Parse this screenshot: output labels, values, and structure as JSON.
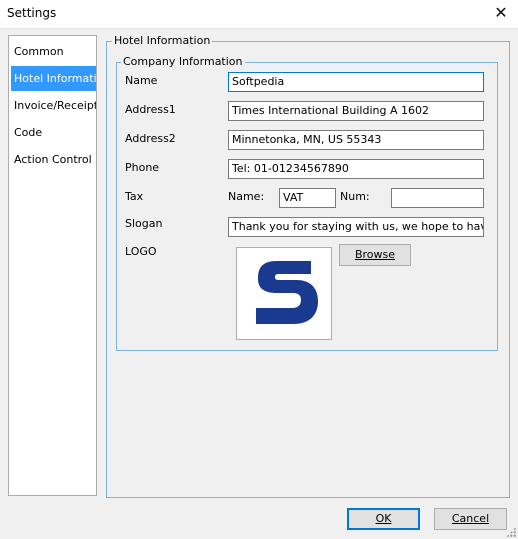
{
  "window": {
    "title": "Settings"
  },
  "nav": {
    "items": [
      {
        "label": "Common"
      },
      {
        "label": "Hotel Information"
      },
      {
        "label": "Invoice/Receipt"
      },
      {
        "label": "Code"
      },
      {
        "label": "Action Control"
      }
    ],
    "selected_index": 1
  },
  "hotel_group": {
    "legend": "Hotel Information"
  },
  "company_group": {
    "legend": "Company Information",
    "name": {
      "label": "Name",
      "value": "Softpedia"
    },
    "address1": {
      "label": "Address1",
      "value": "Times International Building A 1602"
    },
    "address2": {
      "label": "Address2",
      "value": "Minnetonka, MN, US 55343"
    },
    "phone": {
      "label": "Phone",
      "value": "Tel: 01-01234567890"
    },
    "tax": {
      "label": "Tax",
      "name_label": "Name:",
      "name_value": "VAT",
      "num_label": "Num:",
      "num_value": ""
    },
    "slogan": {
      "label": "Slogan",
      "value": "Thank you for staying with us, we hope to have you"
    },
    "logo": {
      "label": "LOGO",
      "browse_label": "Browse"
    }
  },
  "footer": {
    "ok_label": "OK",
    "cancel_label": "Cancel"
  },
  "colors": {
    "selection": "#3399ff",
    "accent": "#0078d7",
    "logo_blue": "#1a3a8f"
  }
}
